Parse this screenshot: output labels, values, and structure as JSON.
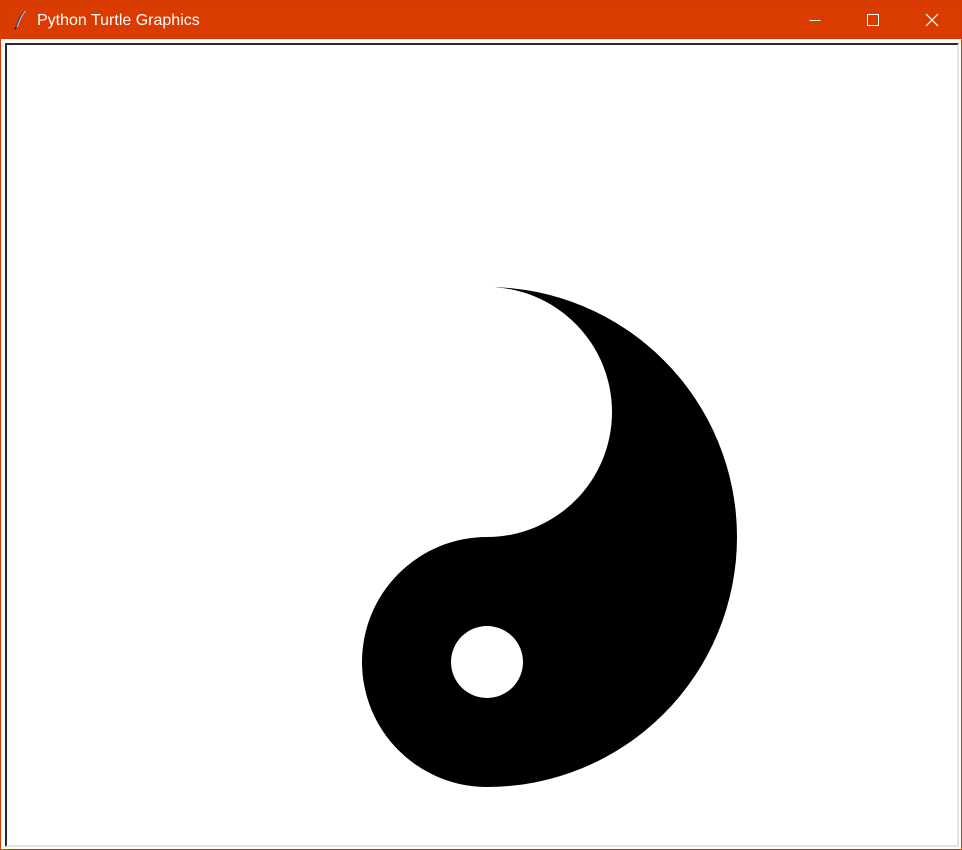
{
  "window": {
    "title": "Python Turtle Graphics",
    "titlebar_color": "#da3b01",
    "controls": [
      "minimize-icon",
      "maximize-icon",
      "close-icon"
    ]
  },
  "canvas": {
    "background": "#ffffff",
    "drawing": "yin-yang-half",
    "fill_color": "#000000",
    "eye_color": "#ffffff"
  }
}
